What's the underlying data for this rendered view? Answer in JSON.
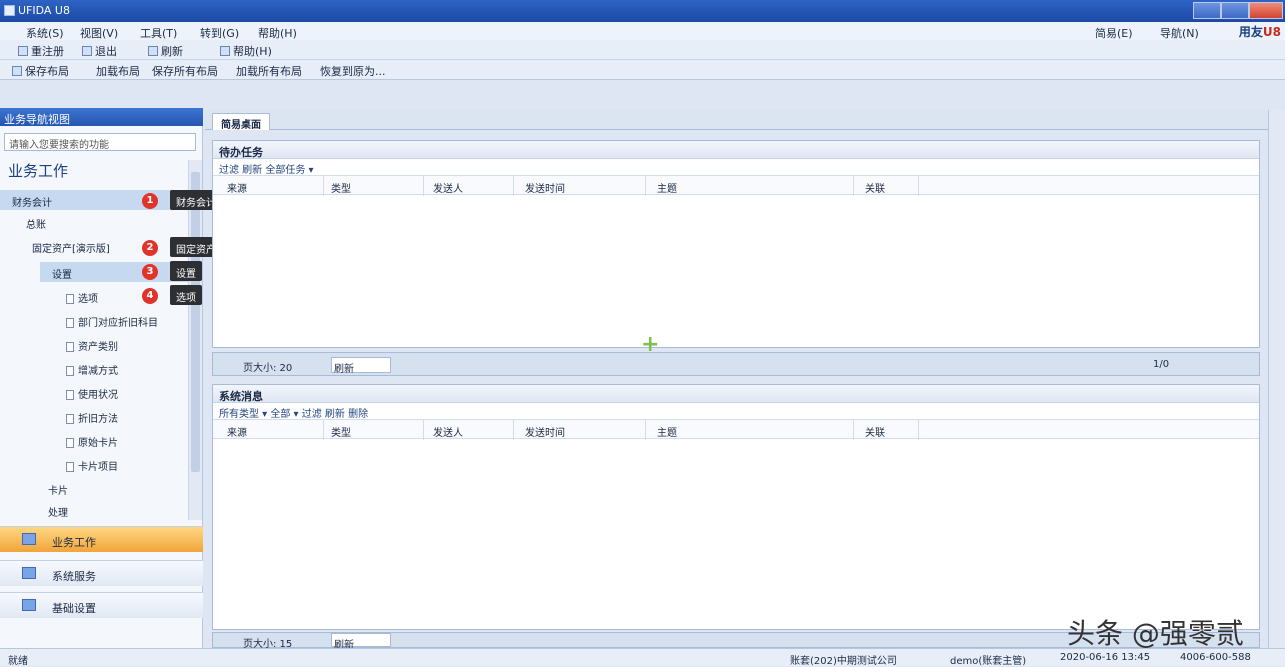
{
  "window": {
    "title": "UFIDA U8"
  },
  "menu": {
    "items": [
      "系统(S)",
      "视图(V)",
      "工具(T)",
      "转到(G)",
      "帮助(H)"
    ],
    "right_items": [
      "简易(E)",
      "导航(N)"
    ],
    "brand_a": "用友",
    "brand_b": "U8"
  },
  "toolbar": {
    "items": [
      "重注册",
      "退出",
      "刷新",
      "帮助(H)"
    ]
  },
  "toolbar2": {
    "items": [
      "保存布局",
      "加载布局",
      "保存所有布局",
      "加载所有布局",
      "恢复到原为..."
    ]
  },
  "sidebar": {
    "header": "业务导航视图",
    "search_placeholder": "请输入您要搜索的功能",
    "title": "业务工作",
    "tree": {
      "n1": "财务会计",
      "n2": "总账",
      "n3": "固定资产[演示版]",
      "n4": "设置",
      "leaf1": "选项",
      "leaf2": "部门对应折旧科目",
      "leaf3": "资产类别",
      "leaf4": "增减方式",
      "leaf5": "使用状况",
      "leaf6": "折旧方法",
      "leaf7": "原始卡片",
      "leaf8": "卡片项目",
      "n5": "卡片",
      "n6": "处理"
    },
    "nav": [
      "业务工作",
      "系统服务",
      "基础设置"
    ]
  },
  "annotations": [
    {
      "num": "1",
      "text": "财务会计"
    },
    {
      "num": "2",
      "text": "固定资产"
    },
    {
      "num": "3",
      "text": "设置"
    },
    {
      "num": "4",
      "text": "选项"
    }
  ],
  "tabs": {
    "home": "简易桌面"
  },
  "panel1": {
    "title": "待办任务",
    "toolbar": "过滤   刷新   全部任务 ▾",
    "columns": [
      "来源",
      "类型",
      "发送人",
      "发送时间",
      "主题",
      "关联"
    ],
    "pager": {
      "size_label": "页大小: 20",
      "select": "刷新",
      "status": "1/0"
    }
  },
  "panel2": {
    "title": "系统消息",
    "toolbar": "所有类型 ▾  全部 ▾  过滤  刷新  删除",
    "columns": [
      "来源",
      "类型",
      "发送人",
      "发送时间",
      "主题",
      "关联"
    ],
    "pager": {
      "size_label": "页大小: 15",
      "select": "刷新"
    }
  },
  "status": {
    "left": "就绪",
    "items": [
      "账套(202)中期测试公司",
      "demo(账套主管)",
      "2020-06-16 13:45",
      "4006-600-588"
    ]
  },
  "watermark": "头条 @强零贰",
  "colors": {
    "title_bar": "#1d4aa6",
    "active_nav": "#f1a43a",
    "badge": "#e0332b"
  }
}
